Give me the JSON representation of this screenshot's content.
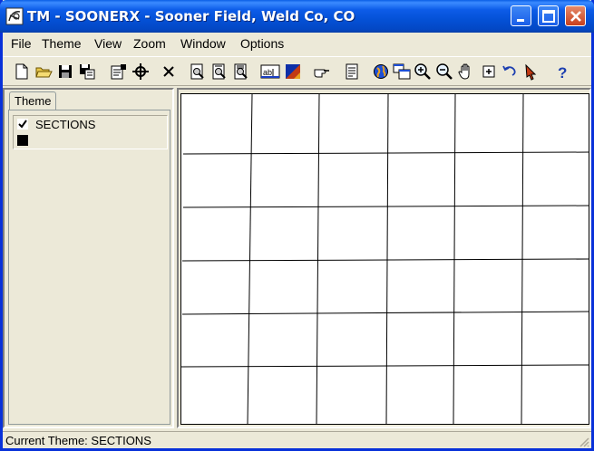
{
  "window": {
    "title": "TM - SOONERX - Sooner Field, Weld Co, CO"
  },
  "menu": {
    "items": [
      {
        "label": "File"
      },
      {
        "label": "Theme"
      },
      {
        "label": "View"
      },
      {
        "label": "Zoom"
      },
      {
        "label": "Window"
      },
      {
        "label": "Options"
      }
    ]
  },
  "toolbar": {
    "tools": [
      {
        "icon": "new-document-icon"
      },
      {
        "icon": "open-folder-icon"
      },
      {
        "icon": "save-disk-icon"
      },
      {
        "icon": "save-as-icon"
      },
      {
        "icon": "properties-icon"
      },
      {
        "icon": "crosshair-icon"
      },
      {
        "icon": "delete-x-icon"
      },
      {
        "icon": "find-icon"
      },
      {
        "icon": "find-next-icon"
      },
      {
        "icon": "find-all-icon"
      },
      {
        "icon": "text-label-icon"
      },
      {
        "icon": "color-fill-icon"
      },
      {
        "icon": "pointing-hand-icon"
      },
      {
        "icon": "report-icon"
      },
      {
        "icon": "globe-icon"
      },
      {
        "icon": "multi-window-icon"
      },
      {
        "icon": "zoom-in-icon"
      },
      {
        "icon": "zoom-out-icon"
      },
      {
        "icon": "pan-hand-icon"
      },
      {
        "icon": "zoom-box-icon"
      },
      {
        "icon": "undo-arrow-icon"
      },
      {
        "icon": "select-arrow-icon"
      },
      {
        "icon": "help-icon"
      }
    ]
  },
  "left_panel": {
    "tab_label": "Theme",
    "themes": [
      {
        "label": "SECTIONS",
        "checked": true,
        "swatch_color": "#000000"
      }
    ]
  },
  "status": {
    "text": "Current Theme: SECTIONS"
  },
  "colors": {
    "title_bar": "#0451d6",
    "window_face": "#ece9d8",
    "map_background": "#ffffff",
    "grid_lines": "#000000"
  }
}
